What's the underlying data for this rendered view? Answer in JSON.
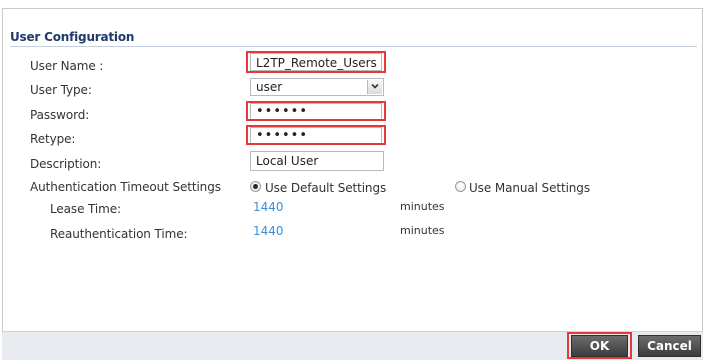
{
  "section": {
    "title": "User Configuration"
  },
  "form": {
    "user_name": {
      "label": "User Name :",
      "value": "L2TP_Remote_Users"
    },
    "user_type": {
      "label": "User Type:",
      "value": "user"
    },
    "password": {
      "label": "Password:",
      "value": "••••••"
    },
    "retype": {
      "label": "Retype:",
      "value": "••••••"
    },
    "description": {
      "label": "Description:",
      "value": "Local User"
    },
    "auth_timeout": {
      "label": "Authentication Timeout Settings",
      "options": [
        {
          "label": "Use Default Settings",
          "checked": true
        },
        {
          "label": "Use Manual Settings",
          "checked": false
        }
      ]
    },
    "lease_time": {
      "label": "Lease Time:",
      "value": "1440",
      "unit": "minutes"
    },
    "reauth_time": {
      "label": "Reauthentication Time:",
      "value": "1440",
      "unit": "minutes"
    }
  },
  "buttons": {
    "ok": "OK",
    "cancel": "Cancel"
  },
  "colors": {
    "highlight": "#e3393b",
    "link_value": "#3b8fd8",
    "title": "#1f3b6a"
  },
  "icons": {
    "select_arrow": "chevron-down-icon",
    "radio": "radio-icon"
  }
}
